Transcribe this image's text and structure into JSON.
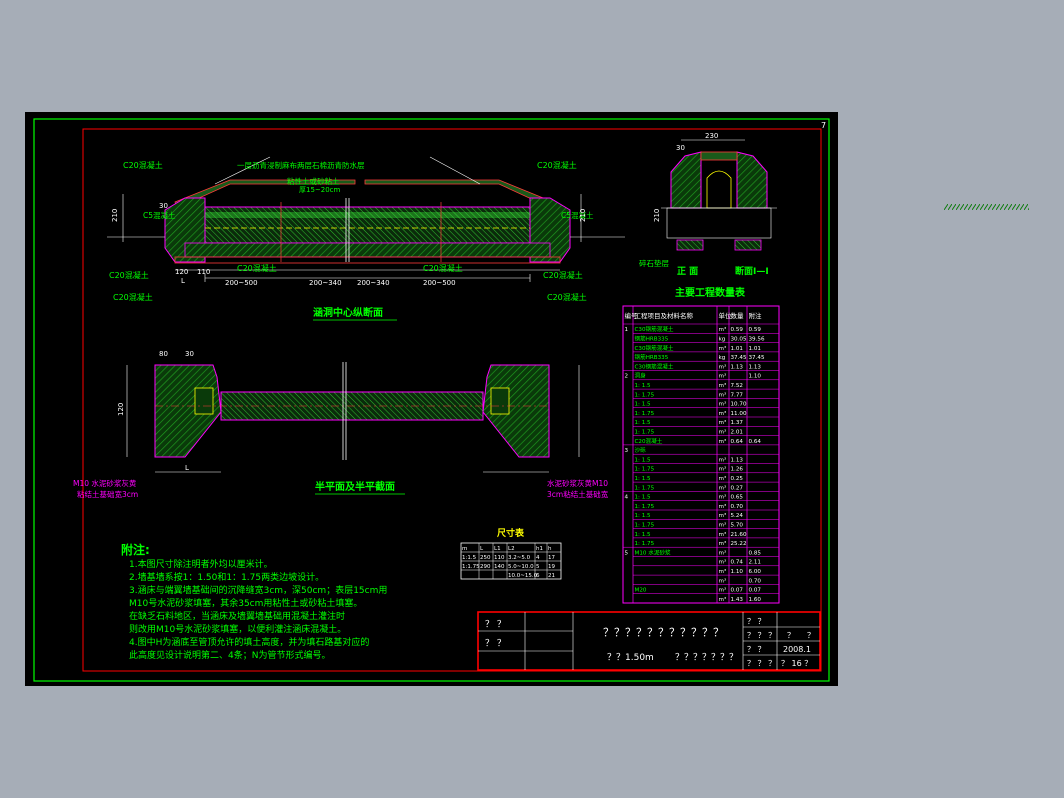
{
  "sheet": {
    "page_number": "7",
    "colors": {
      "background": "#a6adb7",
      "canvas": "#000000",
      "frame": "#00ff00",
      "inner_frame": "#ff0000",
      "outline": "#ff00ff",
      "dimension": "#ffffff",
      "fill": "#1f6b1f",
      "accent": "#ffff00",
      "dash": "#ff3a3a"
    }
  },
  "section_view": {
    "title": "涵洞中心纵断面",
    "labels": {
      "c20_tl": "C20混凝土",
      "c20_tr": "C20混凝土",
      "waterproof": "一层沥青浸制麻布两层石棉沥青防水层",
      "clay": "粘性土或砂粘土",
      "thickness": "厚15~20cm",
      "c5_left": "C5混凝土",
      "c20_mid": "C20混凝土",
      "c5_right": "C5混凝土",
      "c20_bl": "C20混凝土",
      "c20_br": "C20混凝土",
      "c20_lo_left": "C20混凝土",
      "c20_lo_right": "C20混凝土",
      "dim_200_500_a": "200~500",
      "dim_200_340_a": "200~340",
      "dim_200_340_b": "200~340",
      "dim_200_500_b": "200~500",
      "dim_110": "110",
      "dim_120": "120",
      "dim_210_l": "210",
      "dim_210_r": "210",
      "dim_30": "30",
      "dim_l": "L"
    }
  },
  "plan_view": {
    "title": "半平面及半平截面",
    "labels": {
      "mortar_left_1": "M10 水泥砂浆灰黄",
      "mortar_left_2": "粘结土基础宽3cm",
      "mortar_right_1": "水泥砂浆灰黄M10",
      "mortar_right_2": "3cm粘结土基础宽",
      "dim_80": "80",
      "dim_30": "30",
      "dim_120": "120",
      "dim_l": "L"
    }
  },
  "elevation": {
    "label_front": "正  面",
    "label_section": "断面Ⅰ—Ⅰ",
    "dim_top": "230",
    "dim_30": "30",
    "dim_210": "210",
    "stone_label": "碎石垫层"
  },
  "quantity_table": {
    "title": "主要工程数量表",
    "header": [
      "编号",
      "工程项目及材料名称",
      "单位",
      "数量",
      "附注"
    ],
    "rows": [
      [
        "1",
        "C30钢筋混凝土",
        "m³",
        "0.59",
        "0.59"
      ],
      [
        "",
        "钢筋HRB335",
        "kg",
        "30.05",
        "39.56"
      ],
      [
        "",
        "C30钢筋混凝土",
        "m³",
        "1.01",
        "1.01"
      ],
      [
        "",
        "钢筋HRB335",
        "kg",
        "37.45",
        "37.45"
      ],
      [
        "",
        "C30钢筋混凝土",
        "m³",
        "1.13",
        "1.13"
      ],
      [
        "2",
        "洞身",
        "m³",
        "",
        "1.10"
      ],
      [
        "",
        "1: 1.5",
        "m³",
        "7.52",
        ""
      ],
      [
        "",
        "1: 1.75",
        "m³",
        "7.77",
        ""
      ],
      [
        "",
        "1: 1.5",
        "m³",
        "10.70",
        ""
      ],
      [
        "",
        "1: 1.75",
        "m³",
        "11.00",
        ""
      ],
      [
        "",
        "1: 1.5",
        "m³",
        "1.37",
        ""
      ],
      [
        "",
        "1: 1.75",
        "m³",
        "2.01",
        ""
      ],
      [
        "",
        "C20混凝土",
        "m³",
        "0.64",
        "0.64"
      ],
      [
        "3",
        "沙砾",
        "",
        "",
        ""
      ],
      [
        "",
        "1: 1.5",
        "m³",
        "1.13",
        ""
      ],
      [
        "",
        "1: 1.75",
        "m³",
        "1.26",
        ""
      ],
      [
        "",
        "1: 1.5",
        "m³",
        "0.25",
        ""
      ],
      [
        "",
        "1: 1.75",
        "m³",
        "0.27",
        ""
      ],
      [
        "4",
        "1: 1.5",
        "m³",
        "0.65",
        ""
      ],
      [
        "",
        "1: 1.75",
        "m³",
        "0.70",
        ""
      ],
      [
        "",
        "1: 1.5",
        "m³",
        "5.24",
        ""
      ],
      [
        "",
        "1: 1.75",
        "m³",
        "5.70",
        ""
      ],
      [
        "",
        "1: 1.5",
        "m³",
        "21.60",
        ""
      ],
      [
        "",
        "1: 1.75",
        "m³",
        "25.22",
        ""
      ],
      [
        "5",
        "M10 水泥砂浆",
        "m³",
        "",
        "0.85"
      ],
      [
        "",
        "",
        "m³",
        "0.74",
        "2.11"
      ],
      [
        "",
        "",
        "m³",
        "1.10",
        "6.00"
      ],
      [
        "",
        "",
        "m³",
        "",
        "0.70"
      ],
      [
        "",
        "M20",
        "m³",
        "0.07",
        "0.07"
      ],
      [
        "",
        "",
        "m³",
        "1.43",
        "1.60"
      ]
    ]
  },
  "size_table": {
    "title": "尺寸表",
    "header": [
      "m",
      "L",
      "L1",
      "L2",
      "h1",
      "h"
    ],
    "rows": [
      [
        "1:1.5",
        "250",
        "110",
        "3.2~5.0",
        "4",
        "17"
      ],
      [
        "1:1.75",
        "290",
        "140",
        "5.0~10.0",
        "5",
        "19"
      ],
      [
        "",
        "",
        "",
        "10.0~15.0",
        "6",
        "21"
      ]
    ]
  },
  "notes": {
    "heading": "附注:",
    "lines": [
      "1.本图尺寸除注明者外均以厘米计。",
      "2.墙基墙系按1：1.50和1：1.75两类边坡设计。",
      "3.涵床与端翼墙基础间的沉降缝宽3cm，深50cm；表层15cm用",
      "  M10号水泥砂浆填塞，其余35cm用粘性土或砂粘土填塞。",
      "  在缺乏石料地区，当涵床及墙翼墙基础用混凝土灌注时",
      "  则改用M10号水泥砂浆填塞，以便利灌注涵床混凝土。",
      "4.图中H为涵底至管顶允许的填土高度，并为填石路基对应的",
      "  此高度见设计说明第二、4条；N为管节形式编号。"
    ]
  },
  "title_block": {
    "cell_1": "？ ？",
    "cell_2": "？ ？",
    "main_title": "？？？？？？？？？？？",
    "span": "？？1.50m",
    "sub_title": "？？？？？？？",
    "r1a": "？ ？",
    "r2a": "？ ？ ？",
    "r2b": "？",
    "r2c": "？",
    "r3a": "？ ？",
    "date": "2008.1",
    "r4a": "？ ？ ？",
    "sheet_no": "？ 16 ？"
  }
}
